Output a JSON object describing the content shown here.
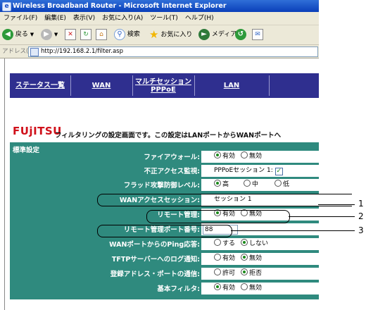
{
  "window": {
    "title": "Wireless Broadband Router - Microsoft Internet Explorer"
  },
  "menu": [
    "ファイル(F)",
    "編集(E)",
    "表示(V)",
    "お気に入り(A)",
    "ツール(T)",
    "ヘルプ(H)"
  ],
  "toolbar": {
    "back": "戻る",
    "search": "検索",
    "favorites": "お気に入り",
    "media": "メディア"
  },
  "address": {
    "label": "アドレス(D)",
    "url": "http://192.168.2.1/filter.asp"
  },
  "nav": {
    "status": "ステータス一覧",
    "wan": "WAN",
    "multi1": "マルチセッション",
    "multi2": "PPPoE",
    "lan": "LAN"
  },
  "brand": {
    "logo": "FUjITSU",
    "description": "フィルタリングの設定画面です。この設定はLANポートからWANポートへ"
  },
  "panel": {
    "section": "標準設定",
    "firewall": {
      "label": "ファイアウォール:",
      "opt1": "有効",
      "opt2": "無効",
      "selected": "有効"
    },
    "illegal": {
      "label": "不正アクセス監視:",
      "value": "PPPoEセッション 1:",
      "checked": true
    },
    "flood": {
      "label": "フラッド攻撃防御レベル:",
      "opt1": "高",
      "opt2": "中",
      "opt3": "低",
      "selected": "高"
    },
    "wansession": {
      "label": "WANアクセスセッション:",
      "value": "セッション 1"
    },
    "remote": {
      "label": "リモート管理:",
      "opt1": "有効",
      "opt2": "無効",
      "selected": "有効"
    },
    "remoteport": {
      "label": "リモート管理ポート番号:",
      "value": "88"
    },
    "ping": {
      "label": "WANポートからのPing応答:",
      "opt1": "する",
      "opt2": "しない",
      "selected": "しない"
    },
    "tftp": {
      "label": "TFTPサーバーへのログ通知:",
      "opt1": "有効",
      "opt2": "無効",
      "selected": "無効"
    },
    "registered": {
      "label": "登録アドレス・ポートの通信:",
      "opt1": "許可",
      "opt2": "拒否",
      "selected": "拒否"
    },
    "basic": {
      "label": "基本フィルタ:",
      "opt1": "有効",
      "opt2": "無効",
      "selected": "有効"
    }
  },
  "callouts": [
    "1",
    "2",
    "3"
  ],
  "colors": {
    "nav": "#2f2f8f",
    "panel": "#2f8a7e",
    "brand": "#d0101a",
    "titlebar": "#0a3fb9"
  }
}
